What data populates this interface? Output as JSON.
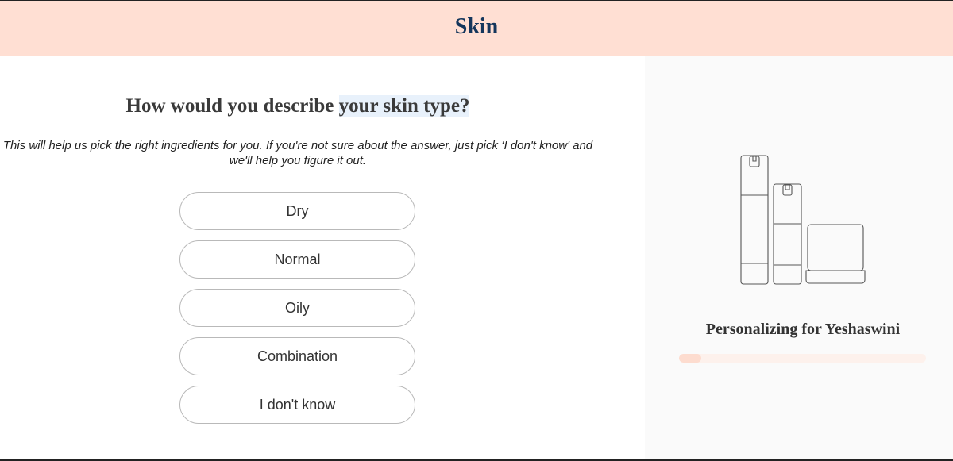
{
  "header": {
    "title": "Skin"
  },
  "question": {
    "prefix": "How would you describe ",
    "highlight": "your skin type?",
    "helper": "This will help us pick the right ingredients for you. If you're not sure about the answer, just pick ‘I don't know' and we'll help you figure it out."
  },
  "options": [
    {
      "label": "Dry"
    },
    {
      "label": "Normal"
    },
    {
      "label": "Oily"
    },
    {
      "label": "Combination"
    },
    {
      "label": "I don't know"
    }
  ],
  "sidebar": {
    "illustration_icon": "skincare-products-icon",
    "personalizing_text": "Personalizing for Yeshaswini",
    "progress_fraction": 0.09
  },
  "colors": {
    "header_bg": "#ffdfd3",
    "title": "#14365c",
    "progress_fill": "#fddccf",
    "progress_track": "#fdf1ec"
  }
}
